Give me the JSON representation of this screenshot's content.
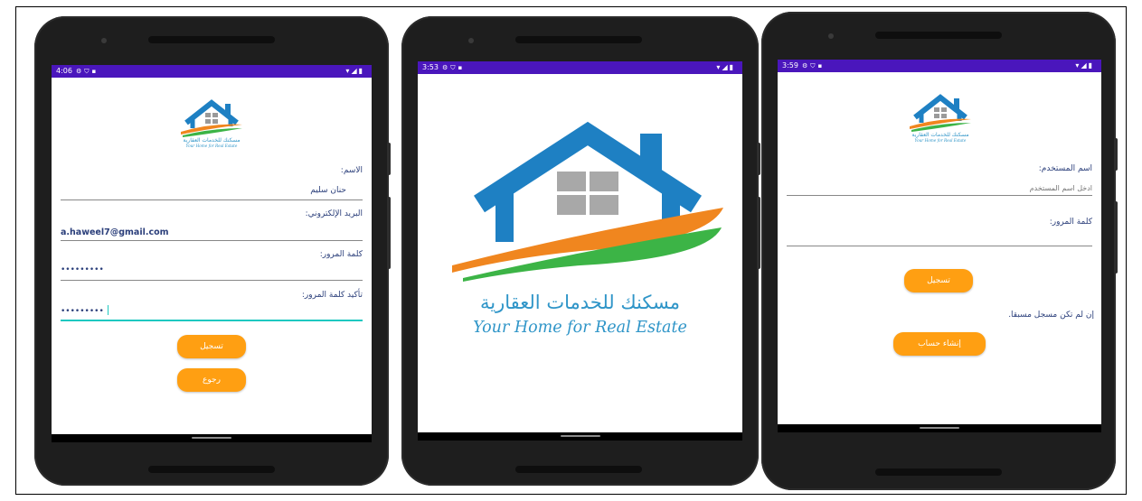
{
  "colors": {
    "status_bar": "#4a16bc",
    "accent_button": "#ff9f12",
    "logo_blue": "#1e80c3",
    "logo_orange": "#f0861f",
    "logo_green": "#3cb446",
    "text_blue": "#2a3e7a",
    "focus_line": "#1ec8c0"
  },
  "logo": {
    "ar_text": "مسكنك للخدمات العقارية",
    "en_text": "Your Home for Real Estate"
  },
  "phones": [
    {
      "screen": "register",
      "status_time": "4:06",
      "status_icons_left": [
        "gear-icon",
        "shield-icon",
        "sim-card-icon"
      ],
      "status_icons_right": [
        "wifi-icon",
        "signal-icon",
        "battery-icon"
      ],
      "fields": {
        "name_label": "الاسم:",
        "name_value": "حنان سليم",
        "email_label": "البريد الإلكتروني:",
        "email_value": "a.haweel7@gmail.com",
        "password_label": "كلمة المرور:",
        "password_value": "•••••••••",
        "confirm_label": "تأكيد كلمة المرور:",
        "confirm_value": "•••••••••"
      },
      "buttons": {
        "register": "تسجيل",
        "back": "رجوع"
      }
    },
    {
      "screen": "splash",
      "status_time": "3:53",
      "status_icons_left": [
        "gear-icon",
        "shield-icon",
        "sim-card-icon"
      ],
      "status_icons_right": [
        "wifi-icon",
        "signal-icon",
        "battery-icon"
      ]
    },
    {
      "screen": "login",
      "status_time": "3:59",
      "status_icons_left": [
        "gear-icon",
        "shield-icon",
        "sim-card-icon"
      ],
      "status_icons_right": [
        "wifi-icon",
        "signal-icon",
        "battery-icon"
      ],
      "fields": {
        "username_label": "اسم المستخدم:",
        "username_placeholder": "ادخل اسم المستخدم",
        "password_label": "كلمة المرور:"
      },
      "buttons": {
        "login": "تسجيل",
        "create_account": "إنشاء حساب"
      },
      "no_account_text": "إن لم تكن مسجل مسبقا."
    }
  ]
}
